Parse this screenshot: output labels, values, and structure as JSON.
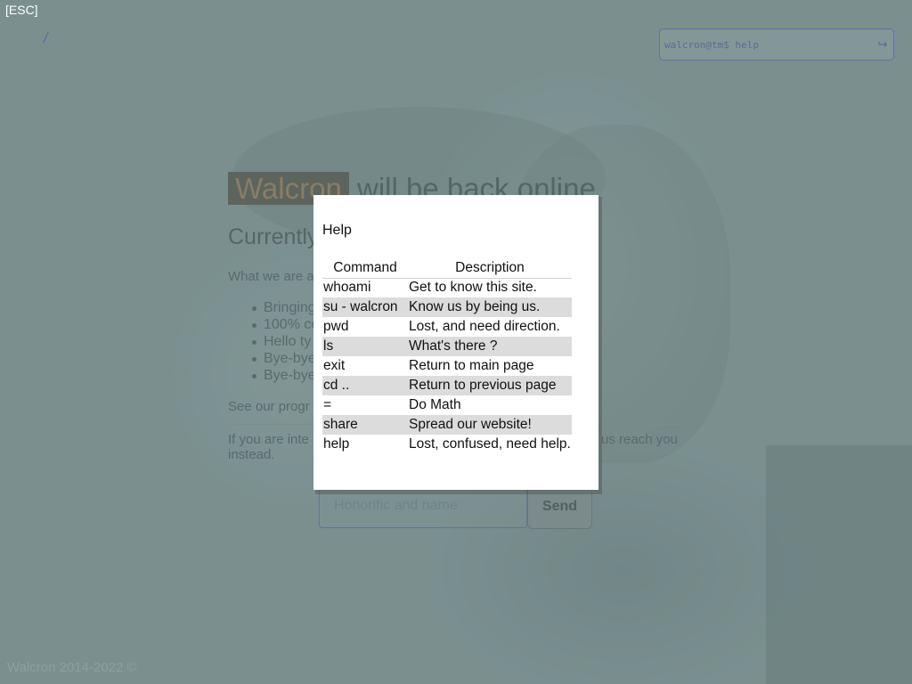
{
  "nav": {
    "esc_label": "[ESC]",
    "path": "/"
  },
  "terminal": {
    "input_value": "walcron@tm$ help",
    "enter_icon": "enter-arrow-icon"
  },
  "background_page": {
    "headline_brand": "Walcron",
    "headline_rest": "will be back online",
    "currently": "Currently",
    "intro": "What we are a",
    "bullets": [
      "Bringing",
      "100% co",
      "Hello ty",
      "Bye-bye",
      "Bye-bye"
    ],
    "see_our": "See our progr",
    "interested": "If you are inte",
    "reach_you": "us reach you",
    "instead": "instead.",
    "name_placeholder": "Honorific and name",
    "send_label": "Send",
    "footer": "Walcron 2014-2022 ©"
  },
  "help_modal": {
    "title": "Help",
    "headers": [
      "Command",
      "Description"
    ],
    "rows": [
      {
        "command": "whoami",
        "description": "Get to know this site."
      },
      {
        "command": "su - walcron",
        "description": "Know us by being us."
      },
      {
        "command": "pwd",
        "description": "Lost, and need direction."
      },
      {
        "command": "ls",
        "description": "What's there ?"
      },
      {
        "command": "exit",
        "description": "Return to main page"
      },
      {
        "command": "cd ..",
        "description": "Return to previous page"
      },
      {
        "command": "=",
        "description": "Do Math"
      },
      {
        "command": "share",
        "description": "Spread our website!"
      },
      {
        "command": "help",
        "description": "Lost, confused, need help."
      }
    ]
  },
  "colors": {
    "overlay": "#5f7878",
    "modal_bg": "#ffffff",
    "row_stripe": "#dcdcdc",
    "brand_highlight": "#a07f5c"
  }
}
